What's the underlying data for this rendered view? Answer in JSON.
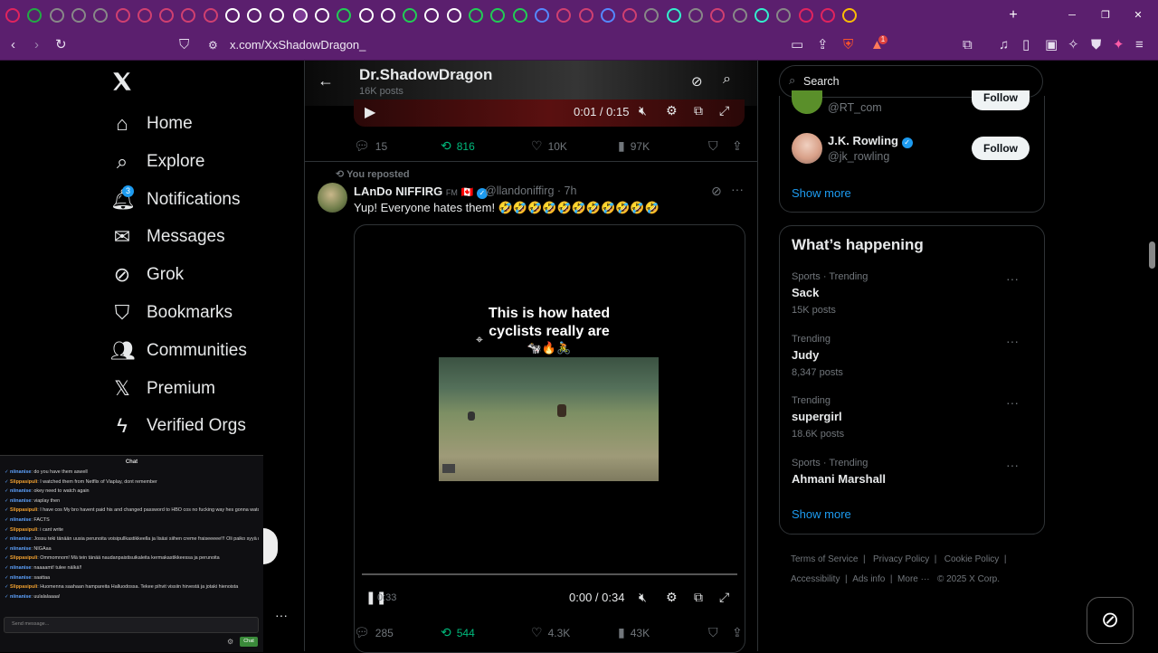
{
  "browser": {
    "url": "x.com/XxShadowDragon_",
    "extension_badge": "1"
  },
  "left_nav": {
    "items": [
      {
        "label": "Home",
        "icon": "home-icon"
      },
      {
        "label": "Explore",
        "icon": "search-icon"
      },
      {
        "label": "Notifications",
        "icon": "bell-icon",
        "badge": "3"
      },
      {
        "label": "Messages",
        "icon": "mail-icon"
      },
      {
        "label": "Grok",
        "icon": "grok-icon"
      },
      {
        "label": "Bookmarks",
        "icon": "bookmark-icon"
      },
      {
        "label": "Communities",
        "icon": "people-icon"
      },
      {
        "label": "Premium",
        "icon": "x-logo-icon"
      },
      {
        "label": "Verified Orgs",
        "icon": "lightning-icon"
      }
    ]
  },
  "profile_header": {
    "name": "Dr.ShadowDragon",
    "posts": "16K posts"
  },
  "top_video": {
    "time": "0:01 / 0:15"
  },
  "post1_actions": {
    "replies": "15",
    "reposts": "816",
    "likes": "10K",
    "views": "97K"
  },
  "post2": {
    "repost_label": "You reposted",
    "author": "LAnDo NIFFIRG",
    "handle": "@llandoniffirg",
    "age": "· 7h",
    "text": "Yup!  Everyone hates them! 🤣🤣🤣🤣🤣🤣🤣🤣🤣🤣🤣",
    "video_caption": "This is how hated cyclists really are",
    "video_emoji": "🐄🔥🚴",
    "video_time": "0:00 / 0:34",
    "video_elapsed": "0:33"
  },
  "post2_actions": {
    "replies": "285",
    "reposts": "544",
    "likes": "4.3K",
    "views": "43K"
  },
  "search": {
    "placeholder": "Search"
  },
  "who_to_follow": [
    {
      "handle": "@RT_com",
      "button": "Follow"
    },
    {
      "name": "J.K. Rowling",
      "handle": "@jk_rowling",
      "button": "Follow"
    }
  ],
  "show_more": "Show more",
  "whats_happening": {
    "title": "What’s happening",
    "trends": [
      {
        "meta": "Sports · Trending",
        "name": "Sack",
        "count": "15K posts"
      },
      {
        "meta": "Trending",
        "name": "Judy",
        "count": "8,347 posts"
      },
      {
        "meta": "Trending",
        "name": "supergirl",
        "count": "18.6K posts"
      },
      {
        "meta": "Sports · Trending",
        "name": "Ahmani Marshall",
        "count": ""
      }
    ],
    "show_more": "Show more"
  },
  "footer": {
    "links": [
      "Terms of Service",
      "Privacy Policy",
      "Cookie Policy",
      "Accessibility",
      "Ads info",
      "More ···"
    ],
    "copyright": "© 2025 X Corp."
  },
  "chat": {
    "title": "Chat",
    "messages": [
      {
        "user": "niinanise",
        "text": "do you have them aswell"
      },
      {
        "user": "Slippasipuli",
        "text": "I watched them from Netflix of Viaplay, dont remember",
        "alt": true
      },
      {
        "user": "niinanise",
        "text": "okey need to watch again"
      },
      {
        "user": "niinanise",
        "text": "viaplay then"
      },
      {
        "user": "Slippasipuli",
        "text": "I have cos My bro havent paid his and changed password to HBO cos no fucking way hes gonna watch For free of i have to play everything 😅",
        "alt": true
      },
      {
        "user": "niinanise",
        "text": "FACTS"
      },
      {
        "user": "Slippasipuli",
        "text": "i cant write",
        "alt": true
      },
      {
        "user": "niinanise",
        "text": "Jossu teki tänään uusia perunoita voisipullkastikkeella ja lisäsi siihen creme fraiseeeee!!! Oli paiko syyä nomnom"
      },
      {
        "user": "niinanise",
        "text": "NIGAaa"
      },
      {
        "user": "Slippasipuli",
        "text": "Ommomnom! Mä tein tänää naudanpaistisuikaleita kermakastikkeessa ja perunoita",
        "alt": true
      },
      {
        "user": "niinanise",
        "text": "naaaamt! tulee nälkä!!"
      },
      {
        "user": "niinanise",
        "text": "saattaa"
      },
      {
        "user": "Slippasipuli",
        "text": "Huomenna saahaan hampareita Halluodossa. Tekee pihvit vissiin hirvestä ja jotaki hienoista",
        "alt": true
      },
      {
        "user": "niinanise",
        "text": "uulalalaaaa!"
      }
    ],
    "input_placeholder": "Send message...",
    "send_label": "Chat"
  }
}
